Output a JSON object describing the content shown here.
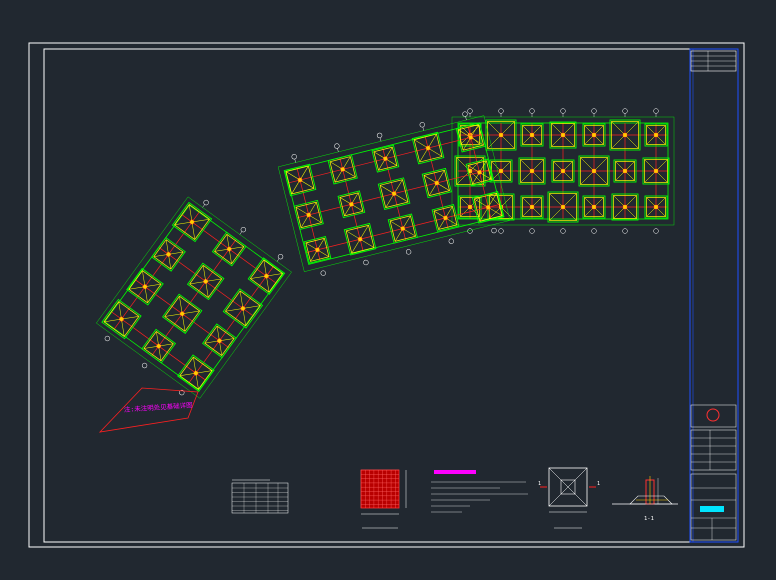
{
  "viewport": {
    "background": "#212830"
  },
  "colors": {
    "frame": "#ffffff",
    "grid": "#00ff00",
    "beam": "#ff2020",
    "footing": "#ffff00",
    "column": "#ffcc00",
    "annotation": "#ff00ff",
    "dim": "#ffffff",
    "titleblock_blue": "#1f4fff",
    "accent_cyan": "#00e5ff"
  },
  "sheet": {
    "name": "foundation-plan-sheet",
    "footing_notes_title_present": true
  },
  "notes": {
    "label": "注:未注明处见基础详图"
  },
  "details": {
    "section_1_label": "1-1",
    "section_2_label": "1-1"
  }
}
